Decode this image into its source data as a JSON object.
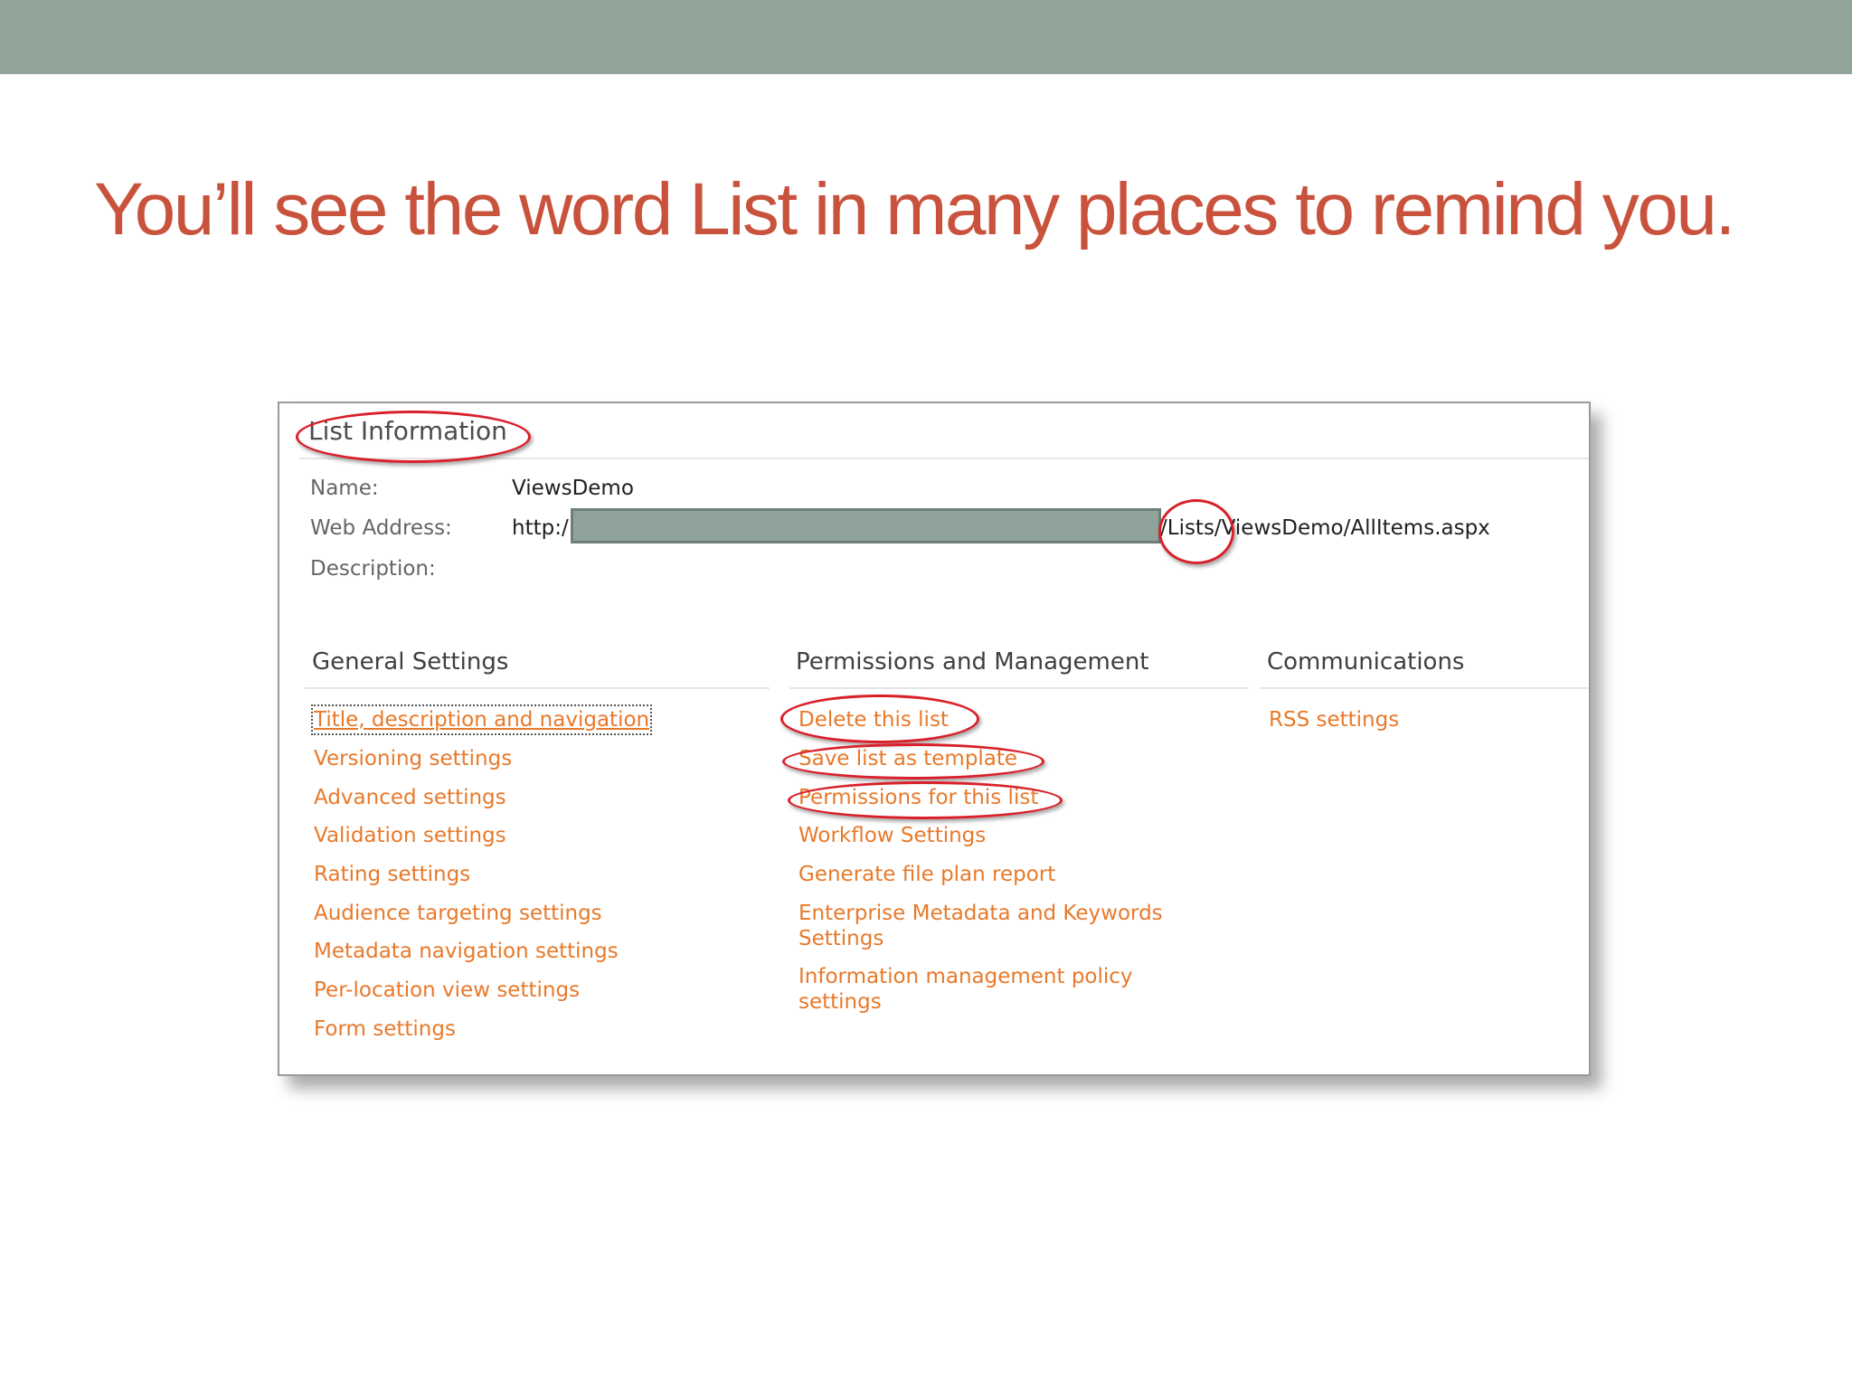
{
  "slide": {
    "title": "You’ll see the word List in many places to remind you."
  },
  "list_info": {
    "heading": "List Information",
    "name_label": "Name:",
    "name_value": "ViewsDemo",
    "web_address_label": "Web Address:",
    "web_address_prefix": "http:/",
    "web_address_suffix": "/Lists/ViewsDemo/AllItems.aspx",
    "description_label": "Description:"
  },
  "general_settings": {
    "title": "General Settings",
    "links": [
      "Title, description and navigation",
      "Versioning settings",
      "Advanced settings",
      "Validation settings",
      "Rating settings",
      "Audience targeting settings",
      "Metadata navigation settings",
      "Per-location view settings",
      "Form settings"
    ]
  },
  "permissions_management": {
    "title": "Permissions and Management",
    "links": [
      "Delete this list",
      "Save list as template",
      "Permissions for this list",
      "Workflow Settings",
      "Generate file plan report",
      "Enterprise Metadata and Keywords Settings",
      "Information management policy settings"
    ]
  },
  "communications": {
    "title": "Communications",
    "links": [
      "RSS settings"
    ]
  },
  "colors": {
    "title_red": "#c8523c",
    "top_bar": "#91a499",
    "link_orange": "#e8792a",
    "annotation_red": "#d9202a"
  }
}
